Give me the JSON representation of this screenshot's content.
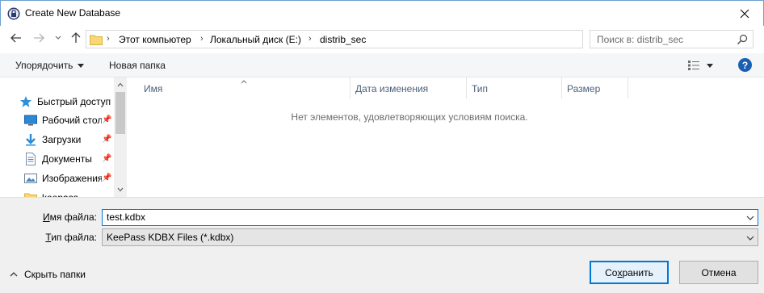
{
  "window": {
    "title": "Create New Database",
    "close_glyph": "✕"
  },
  "address": {
    "crumbs": [
      "Этот компьютер",
      "Локальный диск (E:)",
      "distrib_sec"
    ],
    "search_placeholder": "Поиск в: distrib_sec"
  },
  "toolbar": {
    "organize_label": "Упорядочить",
    "new_folder_label": "Новая папка",
    "help_glyph": "?"
  },
  "nav": {
    "items": [
      {
        "label": "Быстрый доступ",
        "icon": "star-icon"
      },
      {
        "label": "Рабочий стол",
        "icon": "desktop-icon",
        "pinned": true
      },
      {
        "label": "Загрузки",
        "icon": "download-icon",
        "pinned": true
      },
      {
        "label": "Документы",
        "icon": "documents-icon",
        "pinned": true
      },
      {
        "label": "Изображения",
        "icon": "pictures-icon",
        "pinned": true
      },
      {
        "label": "keepass",
        "icon": "folder-icon"
      }
    ]
  },
  "filelist": {
    "columns": [
      "Имя",
      "Дата изменения",
      "Тип",
      "Размер"
    ],
    "empty_message": "Нет элементов, удовлетворяющих условиям поиска."
  },
  "form": {
    "filename_label_u": "И",
    "filename_label_rest": "мя файла:",
    "filename_value": "test.kdbx",
    "filetype_label_u": "Т",
    "filetype_label_rest": "ип файла:",
    "filetype_value": "KeePass KDBX Files (*.kdbx)"
  },
  "footer": {
    "hide_folders_label": "Скрыть папки",
    "save_u": "х",
    "save_pre": "Со",
    "save_post": "ранить",
    "cancel_label": "Отмена"
  },
  "colors": {
    "accent": "#0078d7",
    "help": "#1a5fb4",
    "header_text": "#4c607a"
  }
}
